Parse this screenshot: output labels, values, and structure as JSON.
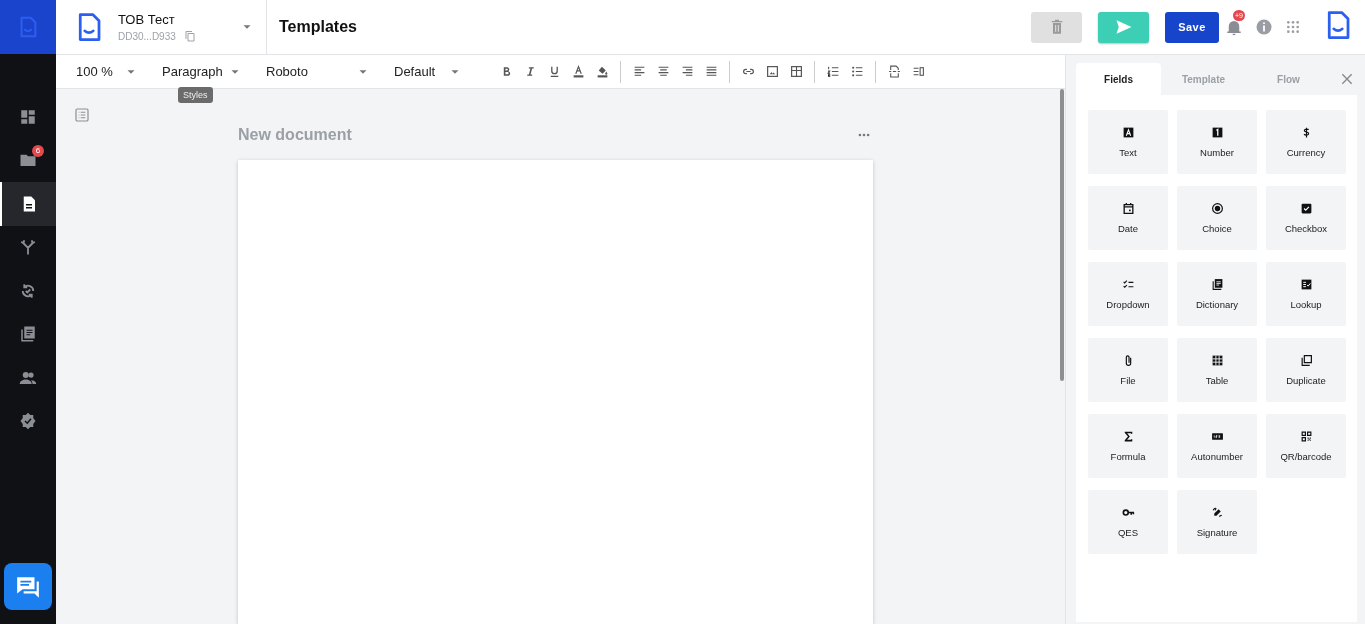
{
  "sidebar": {
    "items": [
      {
        "selected": false
      },
      {
        "selected": false,
        "badge": "6"
      },
      {
        "selected": true
      },
      {
        "selected": false
      },
      {
        "selected": false
      },
      {
        "selected": false
      },
      {
        "selected": false
      },
      {
        "selected": false
      }
    ]
  },
  "header": {
    "org_name": "ТОВ Тест",
    "org_code": "DD30...D933",
    "page_title": "Templates",
    "save_label": "Save",
    "notifications_badge": "+9"
  },
  "toolbar": {
    "dropdowns": [
      "100 %",
      "Paragraph",
      "Roboto",
      "Default"
    ],
    "tooltip": "Styles"
  },
  "document": {
    "title": "New document"
  },
  "panel": {
    "tabs": [
      {
        "label": "Fields",
        "selected": true
      },
      {
        "label": "Template",
        "selected": false
      },
      {
        "label": "Flow",
        "selected": false
      }
    ],
    "fields": [
      "Text",
      "Number",
      "Currency",
      "Date",
      "Choice",
      "Checkbox",
      "Dropdown",
      "Dictionary",
      "Lookup",
      "File",
      "Table",
      "Duplicate",
      "Formula",
      "Autonumber",
      "QR/barcode",
      "QES",
      "Signature"
    ]
  }
}
